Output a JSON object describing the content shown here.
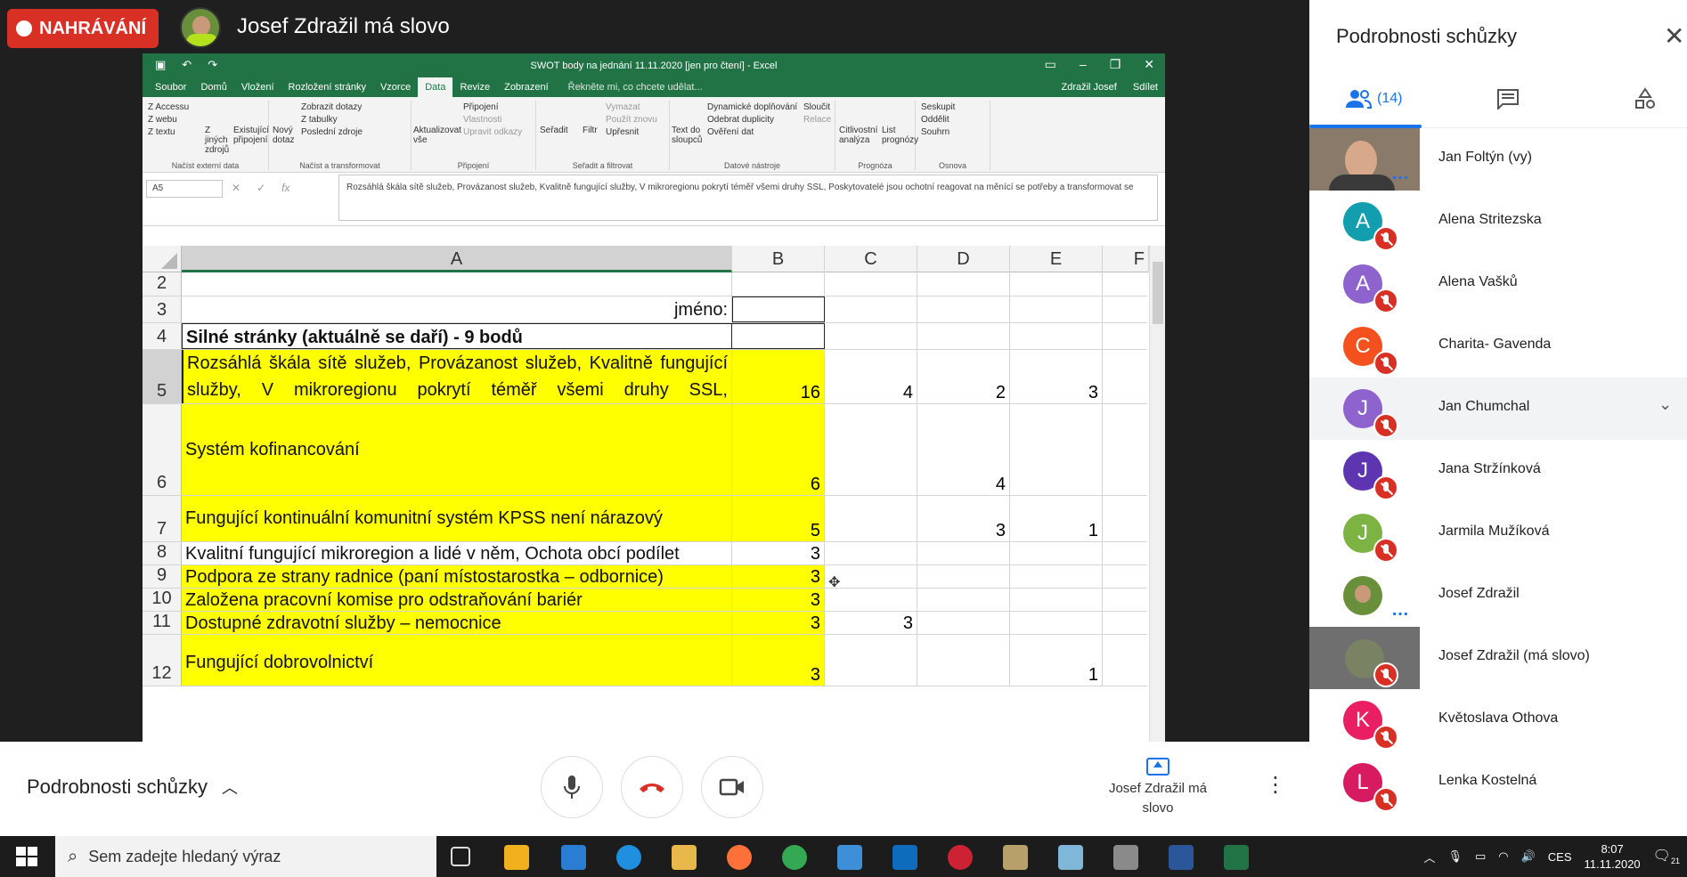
{
  "meeting": {
    "recording_label": "NAHRÁVÁNÍ",
    "presenter_title": "Josef Zdražil má slovo"
  },
  "excel": {
    "window_title": "SWOT body na jednání 11.11.2020  [jen pro čtení]  -  Excel",
    "menu": [
      "Soubor",
      "Domů",
      "Vložení",
      "Rozložení stránky",
      "Vzorce",
      "Data",
      "Revize",
      "Zobrazení"
    ],
    "active_menu": "Data",
    "tell_me": "Řekněte mi, co chcete udělat...",
    "user": "Zdražil Josef",
    "share": "Sdílet",
    "ribbon": {
      "g1": {
        "items": [
          "Z Accessu",
          "Z webu",
          "Z textu",
          "Z jiných zdrojů",
          "Existující připojení"
        ],
        "label": "Načíst externí data"
      },
      "g2": {
        "items": [
          "Nový dotaz",
          "Zobrazit dotazy",
          "Z tabulky",
          "Poslední zdroje"
        ],
        "label": "Načíst a transformovat"
      },
      "g3": {
        "items": [
          "Aktualizovat vše",
          "Připojení",
          "Vlastnosti",
          "Upravit odkazy"
        ],
        "label": "Připojení"
      },
      "g4": {
        "items": [
          "Seřadit",
          "Filtr",
          "Vymazat",
          "Použít znovu",
          "Upřesnit"
        ],
        "label": "Seřadit a filtrovat"
      },
      "g5": {
        "items": [
          "Text do sloupců",
          "Dynamické doplňování",
          "Odebrat duplicity",
          "Ověření dat",
          "Sloučit",
          "Relace"
        ],
        "label": "Datové nástroje"
      },
      "g6": {
        "items": [
          "Citlivostní analýza",
          "List prognózy"
        ],
        "label": "Prognóza"
      },
      "g7": {
        "items": [
          "Seskupit",
          "Oddělit",
          "Souhrn"
        ],
        "label": "Osnova"
      }
    },
    "name_box": "A5",
    "formula": "Rozsáhlá škála sítě služeb, Provázanost služeb, Kvalitně fungující služby, V mikroregionu pokrytí téměř všemi druhy SSL, Poskytovatelé jsou ochotní reagovat na měnící se potřeby a transformovat se",
    "columns": [
      "A",
      "B",
      "C",
      "D",
      "E",
      "F"
    ],
    "rows": [
      {
        "n": "2",
        "a": "",
        "b": "",
        "c": "",
        "d": "",
        "e": ""
      },
      {
        "n": "3",
        "a": "jméno:",
        "b": "",
        "c": "",
        "d": "",
        "e": ""
      },
      {
        "n": "4",
        "a": "Silné stránky (aktuálně se daří) - 9 bodů",
        "b": "",
        "c": "",
        "d": "",
        "e": ""
      },
      {
        "n": "5",
        "a": "Rozsáhlá škála sítě služeb, Provázanost služeb, Kvalitně fungující služby, V mikroregionu pokrytí téměř všemi druhy SSL,",
        "b": "16",
        "c": "4",
        "d": "2",
        "e": "3"
      },
      {
        "n": "6",
        "a": "Systém kofinancování",
        "b": "6",
        "c": "",
        "d": "4",
        "e": ""
      },
      {
        "n": "7",
        "a": "Fungující kontinuální komunitní systém KPSS není nárazový",
        "b": "5",
        "c": "",
        "d": "3",
        "e": "1"
      },
      {
        "n": "8",
        "a": "Kvalitní fungující mikroregion a lidé v něm, Ochota obcí podílet",
        "b": "3",
        "c": "",
        "d": "",
        "e": ""
      },
      {
        "n": "9",
        "a": "Podpora ze strany radnice (paní místostarostka – odbornice)",
        "b": "3",
        "c": "",
        "d": "",
        "e": ""
      },
      {
        "n": "10",
        "a": "Založena pracovní komise pro odstraňování bariér",
        "b": "3",
        "c": "",
        "d": "",
        "e": ""
      },
      {
        "n": "11",
        "a": "Dostupné zdravotní služby – nemocnice",
        "b": "3",
        "c": "3",
        "d": "",
        "e": ""
      },
      {
        "n": "12",
        "a": "Fungující dobrovolnictví",
        "b": "3",
        "c": "",
        "d": "",
        "e": "1"
      }
    ]
  },
  "bottom": {
    "details_label": "Podrobnosti schůzky",
    "present_label": "Josef Zdražil má slovo"
  },
  "panel": {
    "title": "Podrobnosti schůzky",
    "people_count": "(14)",
    "people": [
      {
        "name": "Jan Foltýn (vy)",
        "initial": "",
        "color": ""
      },
      {
        "name": "Alena Stritezska",
        "initial": "A",
        "color": "#129eaf"
      },
      {
        "name": "Alena Vašků",
        "initial": "A",
        "color": "#8e63ce"
      },
      {
        "name": "Charita- Gavenda",
        "initial": "C",
        "color": "#f4511e"
      },
      {
        "name": "Jan Chumchal",
        "initial": "J",
        "color": "#8e63ce"
      },
      {
        "name": "Jana Stržínková",
        "initial": "J",
        "color": "#5e35b1"
      },
      {
        "name": "Jarmila Mužíková",
        "initial": "J",
        "color": "#7cb342"
      },
      {
        "name": "Josef Zdražil",
        "initial": "",
        "color": ""
      },
      {
        "name": "Josef Zdražil (má slovo)",
        "initial": "",
        "color": ""
      },
      {
        "name": "Květoslava Othova",
        "initial": "K",
        "color": "#e91e63"
      },
      {
        "name": "Lenka Kostelná",
        "initial": "L",
        "color": "#d81b60"
      }
    ]
  },
  "taskbar": {
    "search_placeholder": "Sem zadejte hledaný výraz",
    "lang": "CES",
    "time": "8:07",
    "date": "11.11.2020",
    "notif": "21"
  }
}
